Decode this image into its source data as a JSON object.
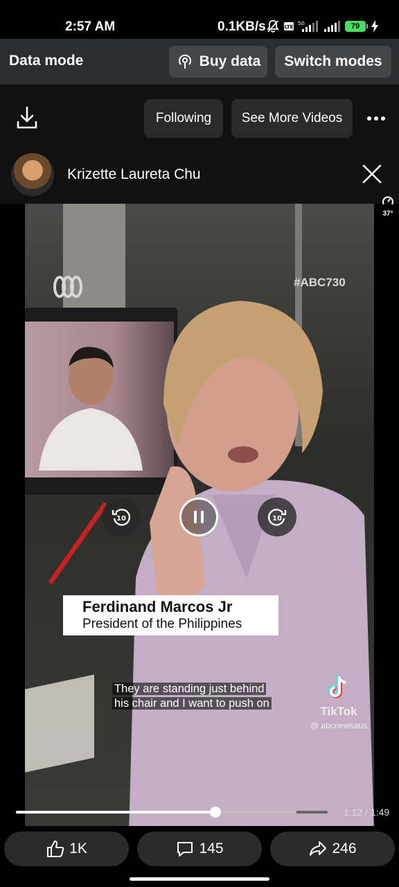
{
  "status_bar": {
    "time": "2:57 AM",
    "network_speed": "0.1KB/s",
    "network_type": "5G",
    "battery": "79"
  },
  "data_mode_bar": {
    "title": "Data mode",
    "buy_data_label": "Buy data",
    "switch_modes_label": "Switch modes"
  },
  "top_bar": {
    "following_label": "Following",
    "see_more_label": "See More Videos"
  },
  "post": {
    "author": "Krizette Laureta Chu"
  },
  "video": {
    "watermark_tag": "#ABC730",
    "lower_third_name": "Ferdinand Marcos Jr",
    "lower_third_title": "President of the Philippines",
    "caption_line1": "They are standing just behind",
    "caption_line2": "his chair and I want to push on",
    "tiktok_brand": "TikTok",
    "tiktok_handle": "@ abcnewsaus",
    "rewind_seconds": "10",
    "forward_seconds": "10",
    "playback_speed": "37°",
    "progress_fraction": 0.64,
    "buffered_fraction": 0.9,
    "timecode": "1:12 / 1:49"
  },
  "actions": {
    "likes": "1K",
    "comments": "145",
    "shares": "246"
  },
  "colors": {
    "battery_green": "#4cd964",
    "data_bar_bg": "#2b2d2f"
  }
}
